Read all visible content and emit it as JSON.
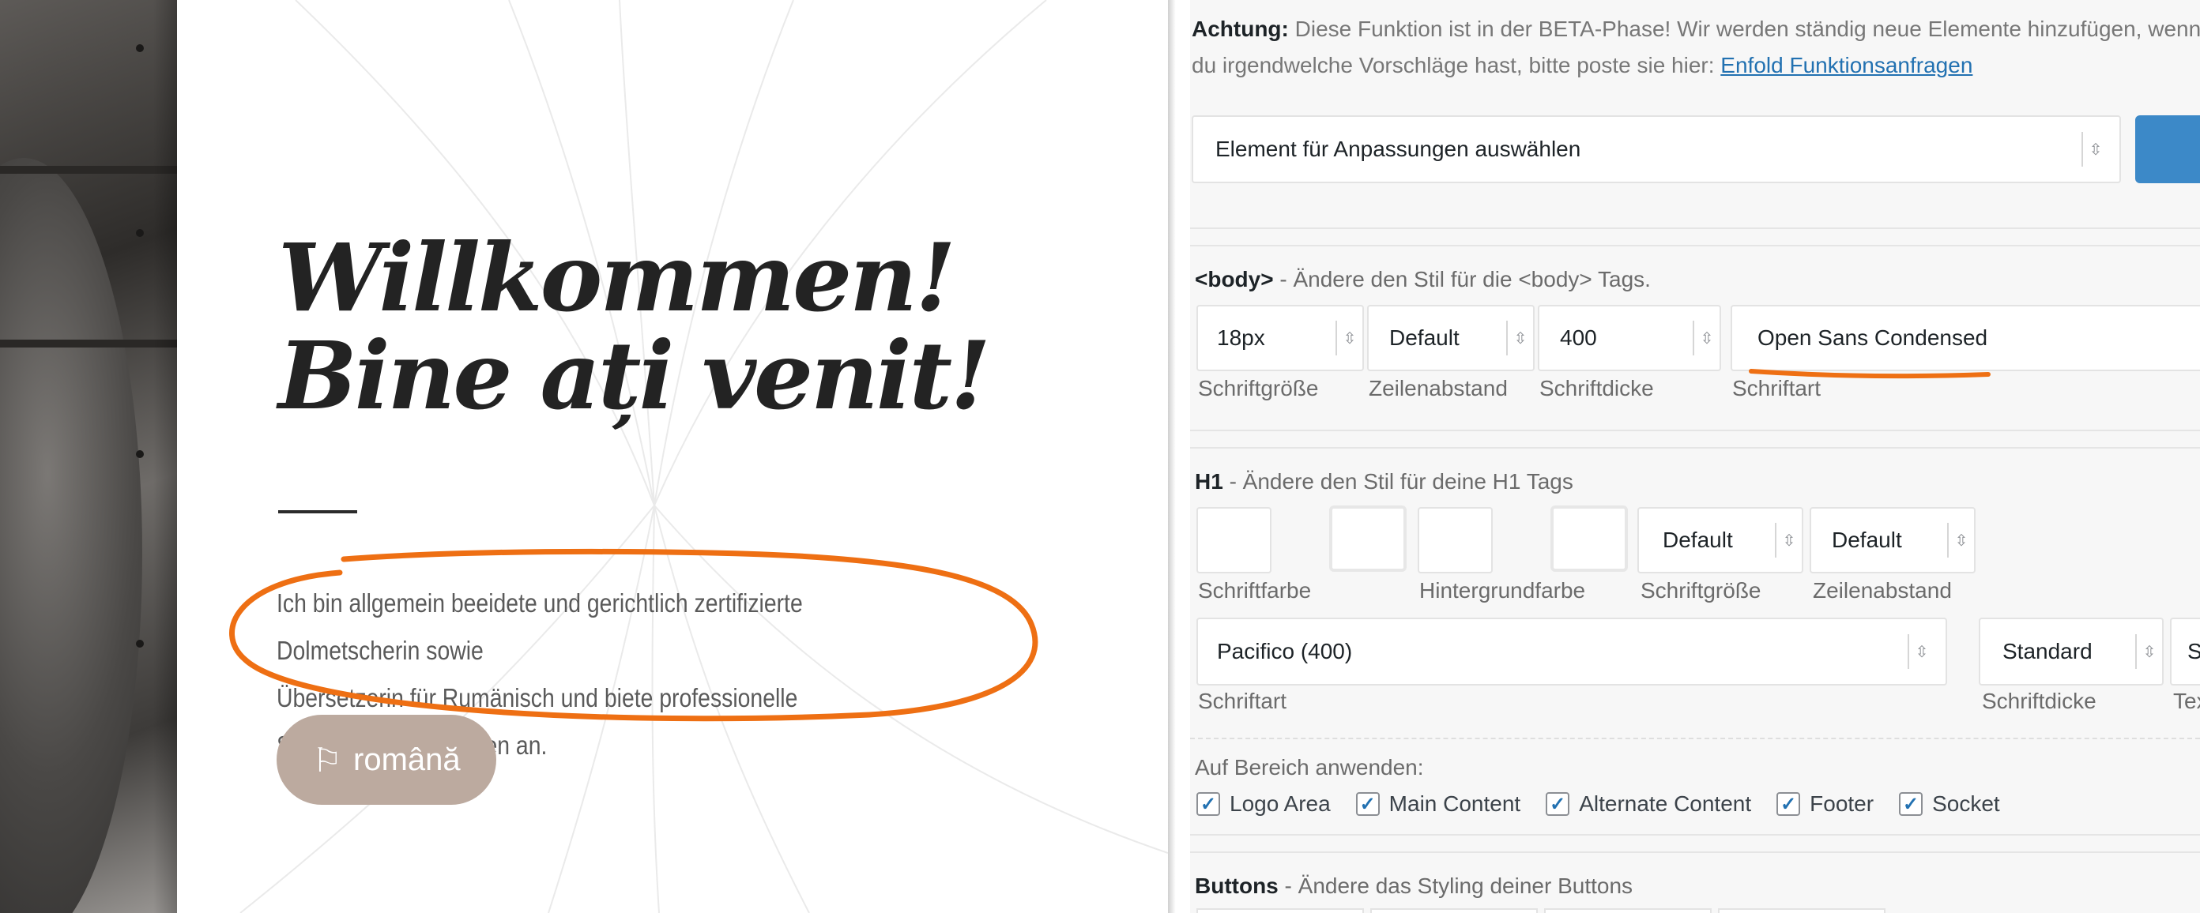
{
  "preview": {
    "heading_line1": "Willkommen!",
    "heading_line2": "Bine ați venit!",
    "intro_line1": "Ich bin allgemein beeidete und gerichtlich zertifizierte Dolmetscherin sowie",
    "intro_line2": "Übersetzerin für Rumänisch und biete professionelle Sprachdienstleistungen an.",
    "language_button": "română",
    "language_button_icon": "signpost-icon",
    "annotation_color": "#ee6f13",
    "button_color": "#bcaa9f"
  },
  "panel": {
    "notice_label": "Achtung:",
    "notice_text_line1": " Diese Funktion ist in der BETA-Phase! Wir werden ständig neue Elemente hinzufügen, wenn",
    "notice_text_line2": "du irgendwelche Vorschläge hast, bitte poste sie hier: ",
    "notice_link": "Enfold Funktionsanfragen",
    "element_select": "Element für Anpassungen auswählen",
    "body_section": {
      "tag": "<body>",
      "description": " - Ändere den Stil für die <body> Tags.",
      "font_size": {
        "value": "18px",
        "label": "Schriftgröße"
      },
      "line_height": {
        "value": "Default",
        "label": "Zeilenabstand"
      },
      "font_weight": {
        "value": "400",
        "label": "Schriftdicke"
      },
      "font_family": {
        "value": "Open Sans Condensed",
        "label": "Schriftart"
      }
    },
    "h1_section": {
      "tag": "H1",
      "description": " - Ändere den Stil für deine H1 Tags",
      "font_color": {
        "label": "Schriftfarbe"
      },
      "background_color": {
        "label": "Hintergrundfarbe"
      },
      "font_size": {
        "value": "Default",
        "label": "Schriftgröße"
      },
      "line_height": {
        "value": "Default",
        "label": "Zeilenabstand"
      },
      "font_family": {
        "value": "Pacifico (400)",
        "label": "Schriftart"
      },
      "font_weight": {
        "value": "Standard",
        "label": "Schriftdicke"
      },
      "text_transform": {
        "value": "S",
        "label": "Tex"
      },
      "apply_label": "Auf Bereich anwenden:",
      "areas": [
        {
          "label": "Logo Area",
          "checked": true
        },
        {
          "label": "Main Content",
          "checked": true
        },
        {
          "label": "Alternate Content",
          "checked": true
        },
        {
          "label": "Footer",
          "checked": true
        },
        {
          "label": "Socket",
          "checked": true
        }
      ]
    },
    "buttons_section": {
      "tag": "Buttons",
      "description": " - Ändere das Styling deiner Buttons"
    },
    "accent_blue": "#3c89c8",
    "link_color": "#2271b1"
  }
}
